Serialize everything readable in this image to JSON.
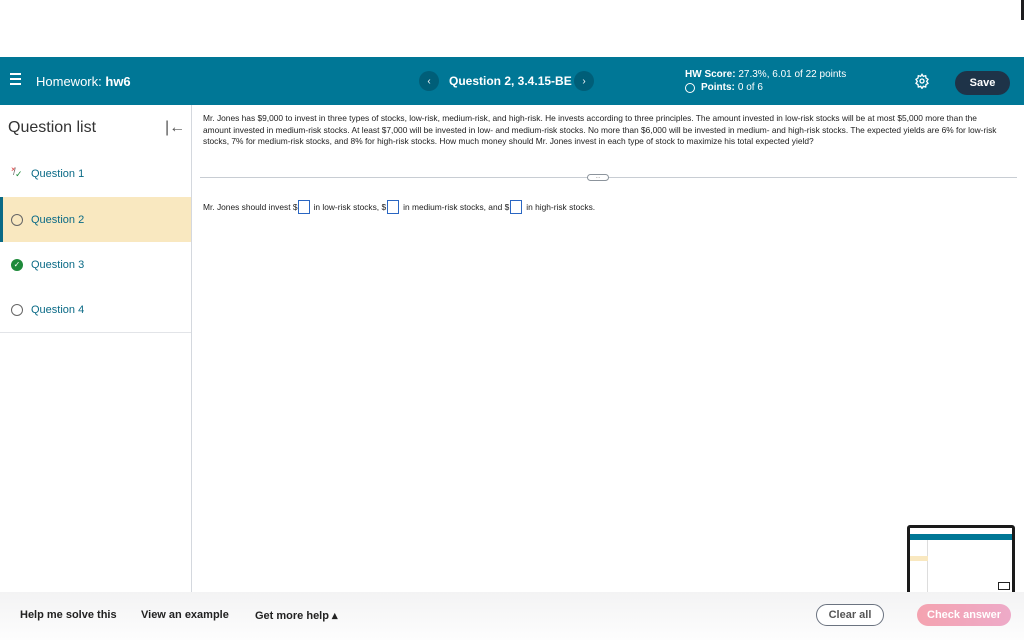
{
  "header": {
    "homework_prefix": "Homework:",
    "homework_name": "hw6",
    "question_title": "Question 2, 3.4.15-BE",
    "prev_icon": "chevron-left-icon",
    "next_icon": "chevron-right-icon",
    "hw_score_label": "HW Score:",
    "hw_score_value": "27.3%, 6.01 of 22 points",
    "points_label": "Points:",
    "points_value": "0 of 6",
    "save_label": "Save",
    "settings_icon": "gear-icon"
  },
  "sidebar": {
    "title": "Question list",
    "collapse_icon": "collapse-left-icon",
    "items": [
      {
        "label": "Question 1",
        "status": "partial"
      },
      {
        "label": "Question 2",
        "status": "unanswered",
        "active": true
      },
      {
        "label": "Question 3",
        "status": "correct"
      },
      {
        "label": "Question 4",
        "status": "unanswered"
      }
    ]
  },
  "problem": {
    "text": "Mr. Jones has $9,000 to invest in three types of stocks, low-risk, medium-risk, and high-risk. He invests according to three principles. The amount invested in low-risk stocks will be at most $5,000 more than the amount invested in medium-risk stocks. At least $7,000 will be invested in low- and medium-risk stocks. No more than $6,000 will be invested in medium- and high-risk stocks. The expected yields are 6% for low-risk stocks, 7% for medium-risk stocks, and 8% for high-risk stocks. How much money should Mr. Jones invest in each type of stock to maximize his total expected yield?",
    "more_label": "…"
  },
  "answer": {
    "part1": "Mr. Jones should invest $",
    "part2": "in low-risk stocks, $",
    "part3": "in medium-risk stocks, and $",
    "part4": "in high-risk stocks.",
    "low_value": "",
    "medium_value": "",
    "high_value": ""
  },
  "footer": {
    "help_solve": "Help me solve this",
    "view_example": "View an example",
    "more_help": "Get more help ▴",
    "clear_all": "Clear all",
    "check_answer": "Check answer"
  },
  "colors": {
    "header_bg": "#007796",
    "active_item_bg": "#f9e8c0",
    "link_color": "#0a6a86",
    "save_bg": "#1e3348",
    "check_answer_bg": "#f4a3b0",
    "correct_green": "#1e8a3a"
  }
}
